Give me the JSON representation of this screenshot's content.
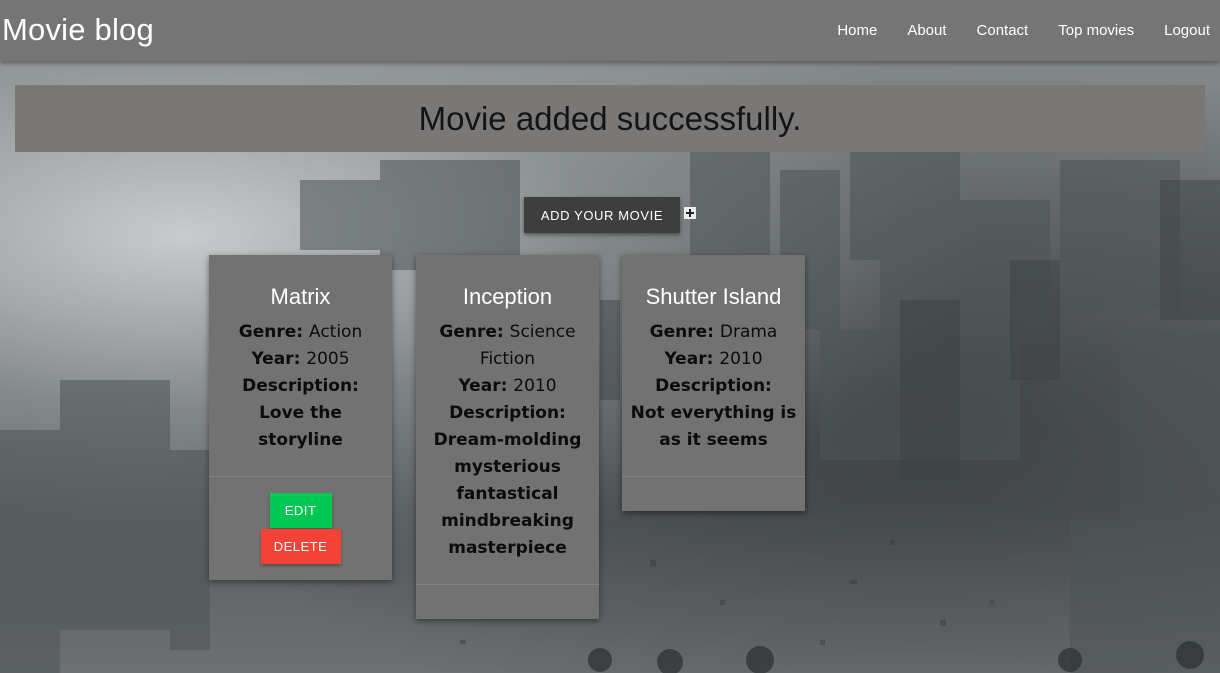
{
  "navbar": {
    "brand": "Movie blog",
    "links": [
      "Home",
      "About",
      "Contact",
      "Top movies",
      "Logout"
    ]
  },
  "alert": {
    "message": "Movie added successfully."
  },
  "add_button": {
    "label": "ADD YOUR MOVIE",
    "icon": "plus-square-icon"
  },
  "labels": {
    "genre": "Genre:",
    "year": "Year:",
    "description": "Description:"
  },
  "movies": [
    {
      "title": "Matrix",
      "genre": "Action",
      "year": "2005",
      "description": "Love the storyline",
      "edit_label": "EDIT",
      "delete_label": "DELETE"
    },
    {
      "title": "Inception",
      "genre": "Science Fiction",
      "year": "2010",
      "description": "Dream-molding mysterious fantastical mindbreaking masterpiece"
    },
    {
      "title": "Shutter Island",
      "genre": "Drama",
      "year": "2010",
      "description": "Not everything is as it seems"
    }
  ],
  "colors": {
    "navbar": "#757575",
    "alert": "#7a7777",
    "card": "#727272",
    "edit_button": "#00c853",
    "delete_button": "#f44336",
    "add_button": "#3e3e3e"
  }
}
